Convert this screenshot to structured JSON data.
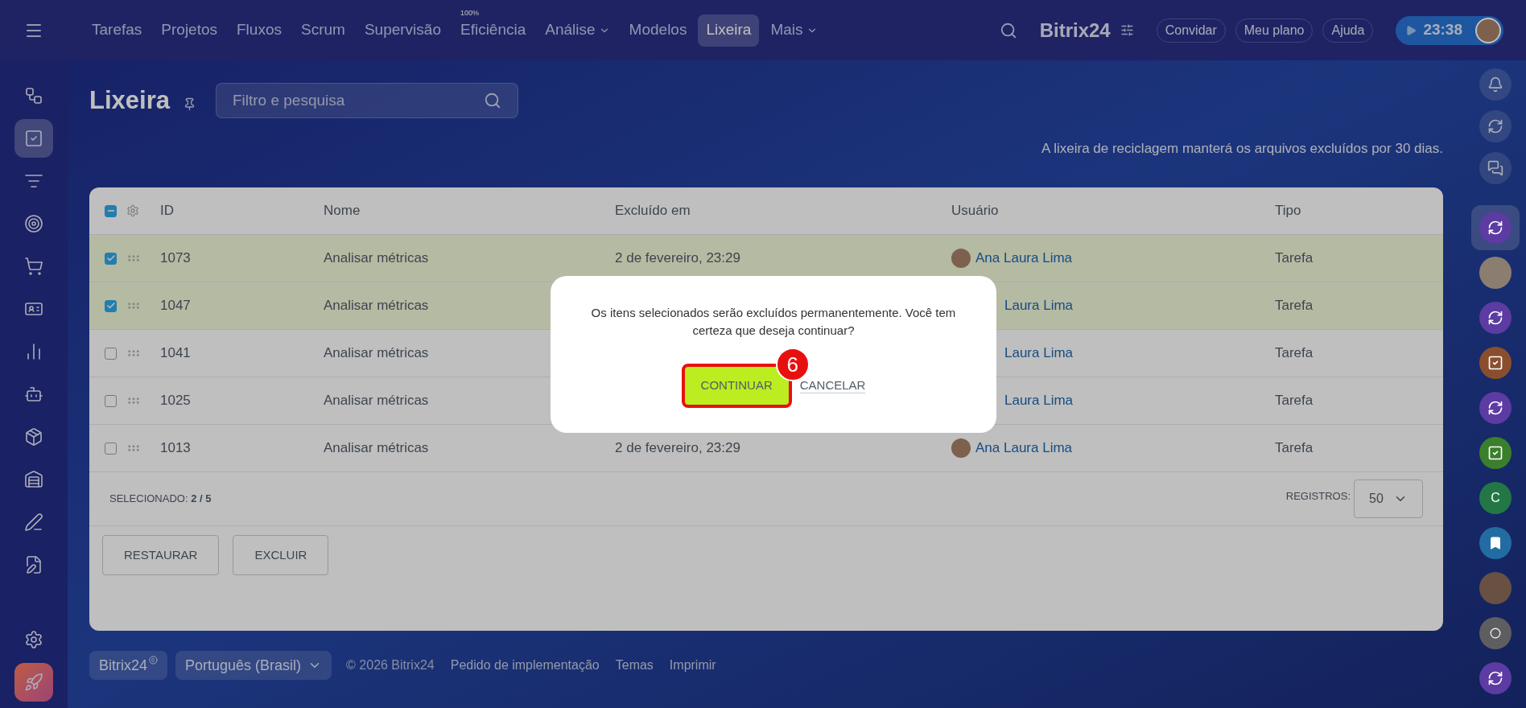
{
  "top_nav": {
    "items": [
      {
        "label": "Tarefas",
        "selected": false,
        "has_caret": false
      },
      {
        "label": "Projetos",
        "selected": false,
        "has_caret": false
      },
      {
        "label": "Fluxos",
        "selected": false,
        "has_caret": false
      },
      {
        "label": "Scrum",
        "selected": false,
        "has_caret": false
      },
      {
        "label": "Supervisão",
        "selected": false,
        "has_caret": false
      },
      {
        "label": "Eficiência",
        "badge": "100%",
        "selected": false,
        "has_caret": false
      },
      {
        "label": "Análise",
        "selected": false,
        "has_caret": true
      },
      {
        "label": "Modelos",
        "selected": false,
        "has_caret": false
      },
      {
        "label": "Lixeira",
        "selected": true,
        "has_caret": false
      },
      {
        "label": "Mais",
        "selected": false,
        "has_caret": true
      }
    ],
    "logo": "Bitrix24",
    "buttons": [
      "Convidar",
      "Meu plano",
      "Ajuda"
    ],
    "timer": "23:38"
  },
  "left_sidebar": [
    {
      "kind": "flow",
      "selected": false
    },
    {
      "kind": "tasks",
      "selected": true
    },
    {
      "kind": "funnel",
      "selected": false
    },
    {
      "kind": "target",
      "selected": false
    },
    {
      "kind": "cart",
      "selected": false
    },
    {
      "kind": "contacts",
      "selected": false
    },
    {
      "kind": "chart",
      "selected": false
    },
    {
      "kind": "robot",
      "selected": false
    },
    {
      "kind": "box",
      "selected": false
    },
    {
      "kind": "warehouse",
      "selected": false
    },
    {
      "kind": "sign",
      "selected": false
    },
    {
      "kind": "document",
      "selected": false
    },
    {
      "kind": "settings",
      "selected": false
    },
    {
      "kind": "rocket",
      "selected": false
    }
  ],
  "right_sidebar": {
    "tools": [
      {
        "kind": "bell"
      },
      {
        "kind": "sync"
      },
      {
        "kind": "chat"
      }
    ],
    "chats": [
      {
        "kind": "sync",
        "color": "#5c3ba2",
        "selected": true
      },
      {
        "kind": "photo",
        "color": "#8b7e71",
        "selected": false
      },
      {
        "kind": "sync",
        "color": "#5c3ba2",
        "selected": false
      },
      {
        "kind": "task",
        "color": "#8a4e2f",
        "selected": false
      },
      {
        "kind": "sync",
        "color": "#5c3ba2",
        "selected": false
      },
      {
        "kind": "task",
        "color": "#3b7e2c",
        "selected": false
      },
      {
        "kind": "letter",
        "letter": "C",
        "color": "#237745",
        "selected": false
      },
      {
        "kind": "bookmark",
        "color": "#236ca2",
        "selected": false
      },
      {
        "kind": "photo",
        "color": "#685042",
        "selected": false
      },
      {
        "kind": "dot",
        "color": "#5e5e60",
        "selected": false
      },
      {
        "kind": "sync",
        "color": "#5c3ba2",
        "selected": false
      }
    ]
  },
  "page": {
    "title": "Lixeira",
    "search": {
      "placeholder": "Filtro e pesquisa"
    },
    "info": "A lixeira de reciclagem manterá os arquivos excluídos por 30 dias."
  },
  "table": {
    "header_partial": true,
    "columns": [
      "ID",
      "Nome",
      "Excluído em",
      "Usuário",
      "Tipo"
    ],
    "rows": [
      {
        "selected": true,
        "id": "1073",
        "name": "Analisar métricas",
        "deleted": "2 de fevereiro, 23:29",
        "user": "Ana Laura Lima",
        "user_avatar": true,
        "type": "Tarefa"
      },
      {
        "selected": true,
        "id": "1047",
        "name": "Analisar métricas",
        "user": "Laura Lima",
        "user_avatar": false,
        "type": "Tarefa"
      },
      {
        "selected": false,
        "id": "1041",
        "name": "Analisar métricas",
        "user": "Laura Lima",
        "user_avatar": false,
        "type": "Tarefa"
      },
      {
        "selected": false,
        "id": "1025",
        "name": "Analisar métricas",
        "user": "Laura Lima",
        "user_avatar": false,
        "type": "Tarefa"
      },
      {
        "selected": false,
        "id": "1013",
        "name": "Analisar métricas",
        "deleted": "2 de fevereiro, 23:29",
        "user": "Ana Laura Lima",
        "user_avatar": true,
        "type": "Tarefa"
      }
    ],
    "selected_label": "SELECIONADO:",
    "selected_count": "2 / 5",
    "page_size_label": "REGISTROS:",
    "page_size": "50"
  },
  "actions": [
    "RESTAURAR",
    "EXCLUIR"
  ],
  "dialog": {
    "message": "Os itens selecionados serão excluídos permanentemente. Você tem certeza que deseja continuar?",
    "confirm": "CONTINUAR",
    "cancel": "CANCELAR",
    "step": "6"
  },
  "footer": {
    "brand": "Bitrix24",
    "language": "Português (Brasil)",
    "copyright": "© 2026 Bitrix24",
    "links": [
      "Pedido de implementação",
      "Temas",
      "Imprimir"
    ]
  }
}
